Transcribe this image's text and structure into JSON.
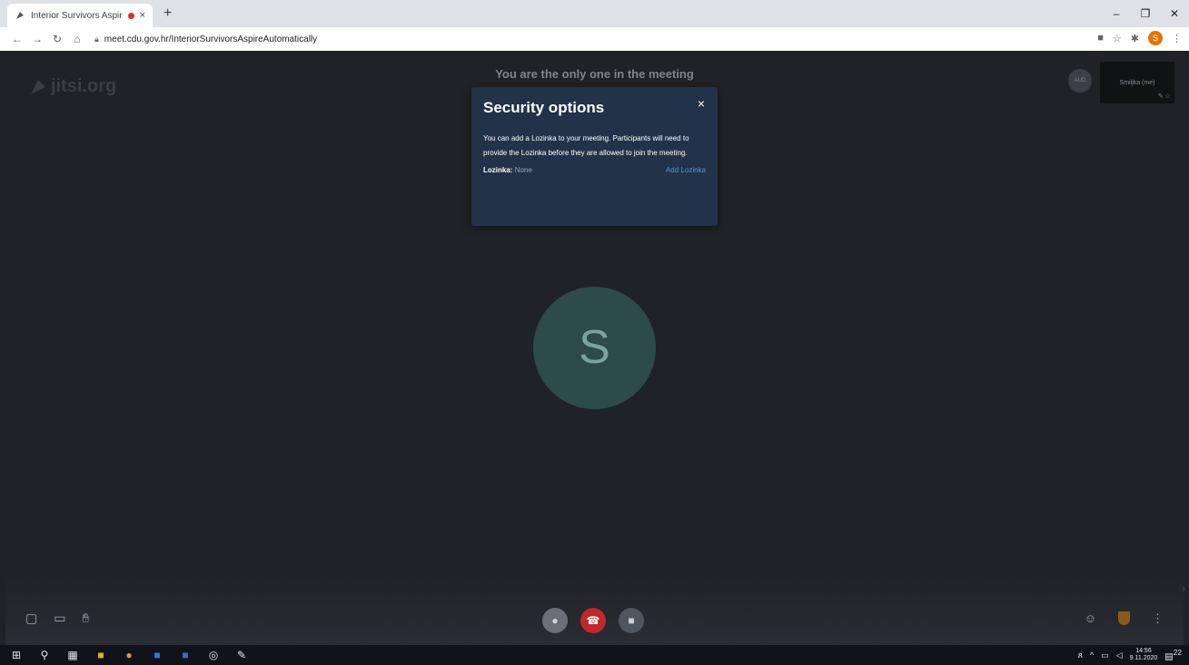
{
  "browser": {
    "tab_title": "Interior Survivors Aspire Aut",
    "tab_close": "×",
    "new_tab": "+",
    "url": "meet.cdu.gov.hr/InteriorSurvivorsAspireAutomatically",
    "window_controls": {
      "minimize": "–",
      "restore": "❐",
      "close": "✕"
    },
    "profile_initial": "S"
  },
  "meeting": {
    "watermark": "jitsi.org",
    "notice": "You are the only one in the meeting",
    "big_avatar_initial": "S",
    "self_thumb_name": "Smiljka (me)",
    "other_avatar_label": "AUD"
  },
  "security_dialog": {
    "title": "Security options",
    "close": "×",
    "description": "You can add a Lozinka to your meeting. Participants will need to provide the Lozinka before they are allowed to join the meeting.",
    "label": "Lozinka:",
    "value": "None",
    "add_action": "Add Lozinka"
  },
  "taskbar": {
    "time": "14:56",
    "date": "9.11.2020",
    "notifications": "22"
  },
  "colors": {
    "dialog_bg": "#223248",
    "link": "#4a9ae0",
    "hangup": "#c0282d",
    "avatar": "#2d4b48"
  }
}
